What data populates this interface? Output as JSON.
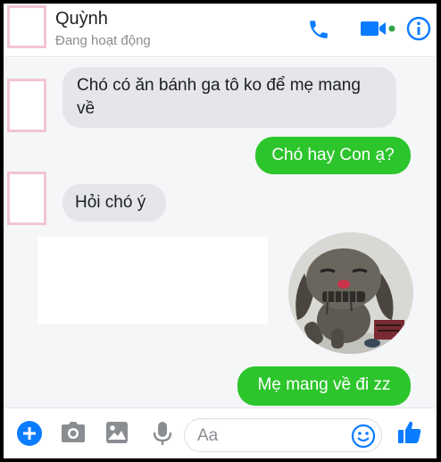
{
  "header": {
    "contact_name": "Quỳnh",
    "status": "Đang hoạt động"
  },
  "messages": [
    {
      "direction": "incoming",
      "text": "Chó có ăn bánh ga tô ko để mẹ mang về"
    },
    {
      "direction": "outgoing",
      "text": "Chó hay Con ạ?"
    },
    {
      "direction": "incoming",
      "text": "Hỏi chó ý"
    },
    {
      "direction": "incoming",
      "type": "image"
    },
    {
      "direction": "outgoing",
      "type": "sticker",
      "icon": "sad-dog-sticker"
    },
    {
      "direction": "outgoing",
      "text": "Mẹ mang về đi zz"
    }
  ],
  "composer": {
    "placeholder": "Aa",
    "value": ""
  },
  "colors": {
    "accent": "#0a7cff",
    "outgoing_bubble": "#2cc52c",
    "incoming_bubble": "#e4e6eb",
    "online_dot": "#31a24c"
  }
}
